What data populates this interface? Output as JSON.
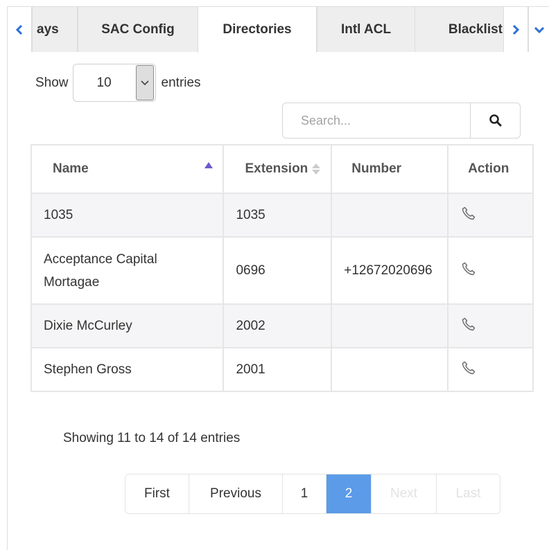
{
  "tabs": {
    "items": [
      {
        "label": "ays"
      },
      {
        "label": "SAC Config"
      },
      {
        "label": "Directories",
        "active": true
      },
      {
        "label": "Intl ACL"
      },
      {
        "label": "Blacklist"
      }
    ]
  },
  "length": {
    "show_label": "Show",
    "value": "10",
    "entries_label": "entries"
  },
  "search": {
    "placeholder": "Search...",
    "value": ""
  },
  "table": {
    "headers": {
      "name": "Name",
      "extension": "Extension",
      "number": "Number",
      "action": "Action"
    },
    "rows": [
      {
        "name": "1035",
        "extension": "1035",
        "number": ""
      },
      {
        "name": "Acceptance Capital Mortagae",
        "extension": "0696",
        "number": "+12672020696"
      },
      {
        "name": "Dixie McCurley",
        "extension": "2002",
        "number": ""
      },
      {
        "name": "Stephen Gross",
        "extension": "2001",
        "number": ""
      }
    ]
  },
  "info": "Showing 11 to 14 of 14 entries",
  "pagination": {
    "first": "First",
    "previous": "Previous",
    "page1": "1",
    "page2": "2",
    "next": "Next",
    "last": "Last"
  },
  "colors": {
    "accent": "#5b9be8",
    "sort_active": "#6a5acd",
    "icon_blue": "#2a6fd6"
  }
}
